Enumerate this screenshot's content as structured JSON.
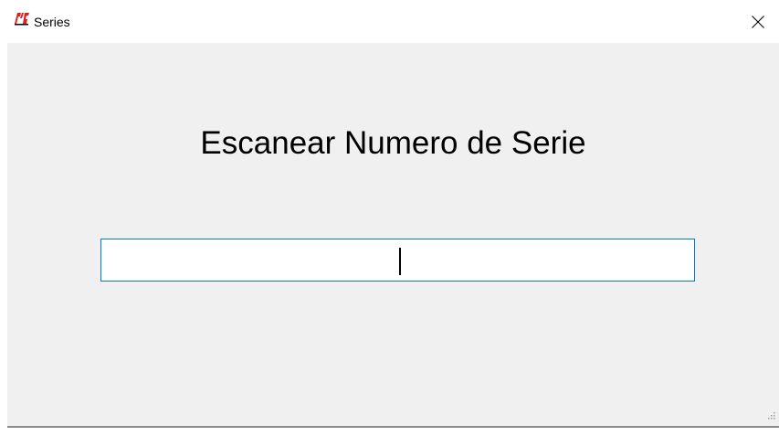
{
  "window": {
    "title": "Series",
    "icon": "series-app-icon",
    "close_icon": "close-icon"
  },
  "main": {
    "heading": "Escanear Numero de Serie",
    "serial_input": {
      "value": "",
      "placeholder": ""
    }
  },
  "colors": {
    "client_background": "#f0f0f0",
    "input_border": "#0078d7",
    "icon_red": "#e02020"
  }
}
